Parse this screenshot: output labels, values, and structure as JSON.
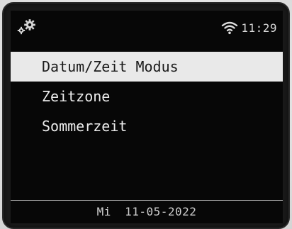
{
  "status_bar": {
    "settings_icon": "settings-gears-icon",
    "wifi_icon": "wifi-icon",
    "time": "11:29"
  },
  "menu": {
    "items": [
      {
        "label": "Datum/Zeit Modus",
        "selected": true
      },
      {
        "label": "Zeitzone",
        "selected": false
      },
      {
        "label": "Sommerzeit",
        "selected": false
      }
    ]
  },
  "footer": {
    "day": "Mi",
    "date": "11-05-2022"
  },
  "colors": {
    "background": "#070707",
    "selected_bg": "#e9e9e9",
    "text": "#ececec"
  }
}
